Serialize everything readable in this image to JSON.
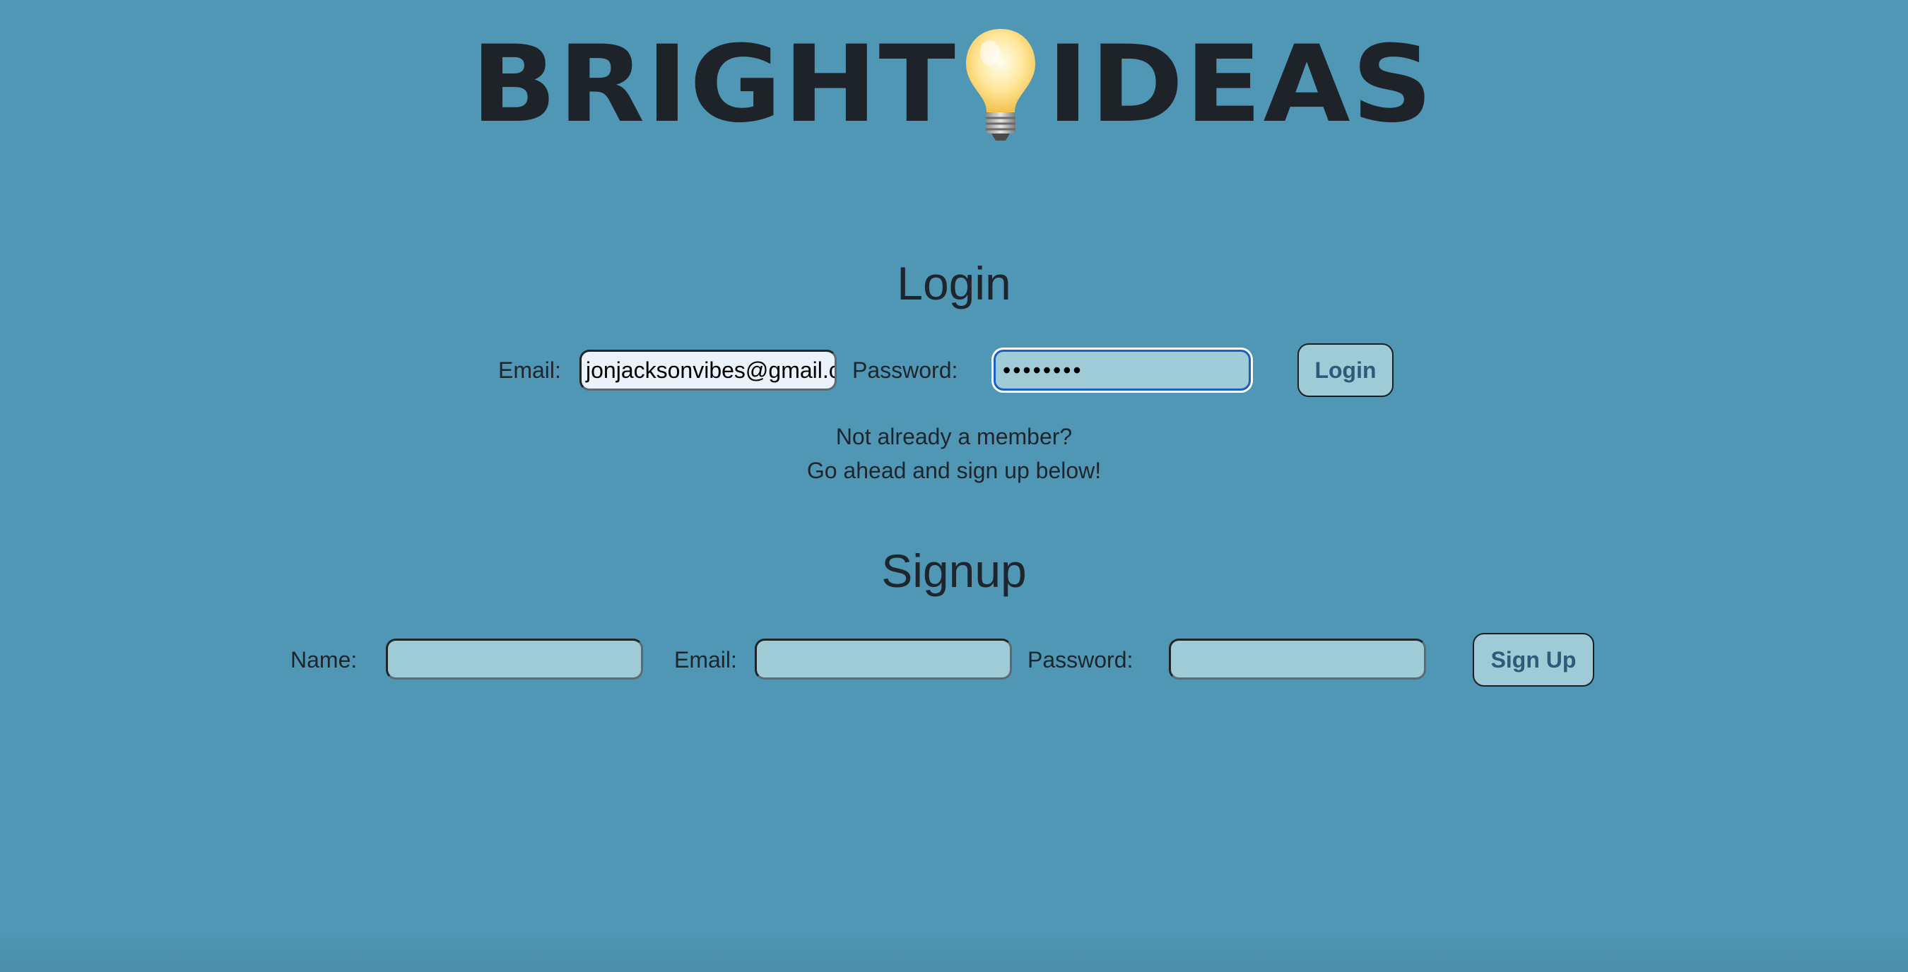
{
  "logo": {
    "word_left": "BRIGHT",
    "word_right": "IDEAS",
    "icon": "lightbulb-icon"
  },
  "login": {
    "heading": "Login",
    "email_label": "Email:",
    "email_value": "jonjacksonvibes@gmail.com",
    "password_label": "Password:",
    "password_value": "••••••••",
    "button_label": "Login"
  },
  "prompt": {
    "line1": "Not already a member?",
    "line2": "Go ahead and sign up below!"
  },
  "signup": {
    "heading": "Signup",
    "name_label": "Name:",
    "name_value": "",
    "email_label": "Email:",
    "email_value": "",
    "password_label": "Password:",
    "password_value": "",
    "button_label": "Sign Up"
  },
  "colors": {
    "background": "#4f97b5",
    "field": "#9ecbd6",
    "text": "#1f252c",
    "button_text": "#2c5c7a",
    "focus_ring": "#1a5fc4"
  }
}
